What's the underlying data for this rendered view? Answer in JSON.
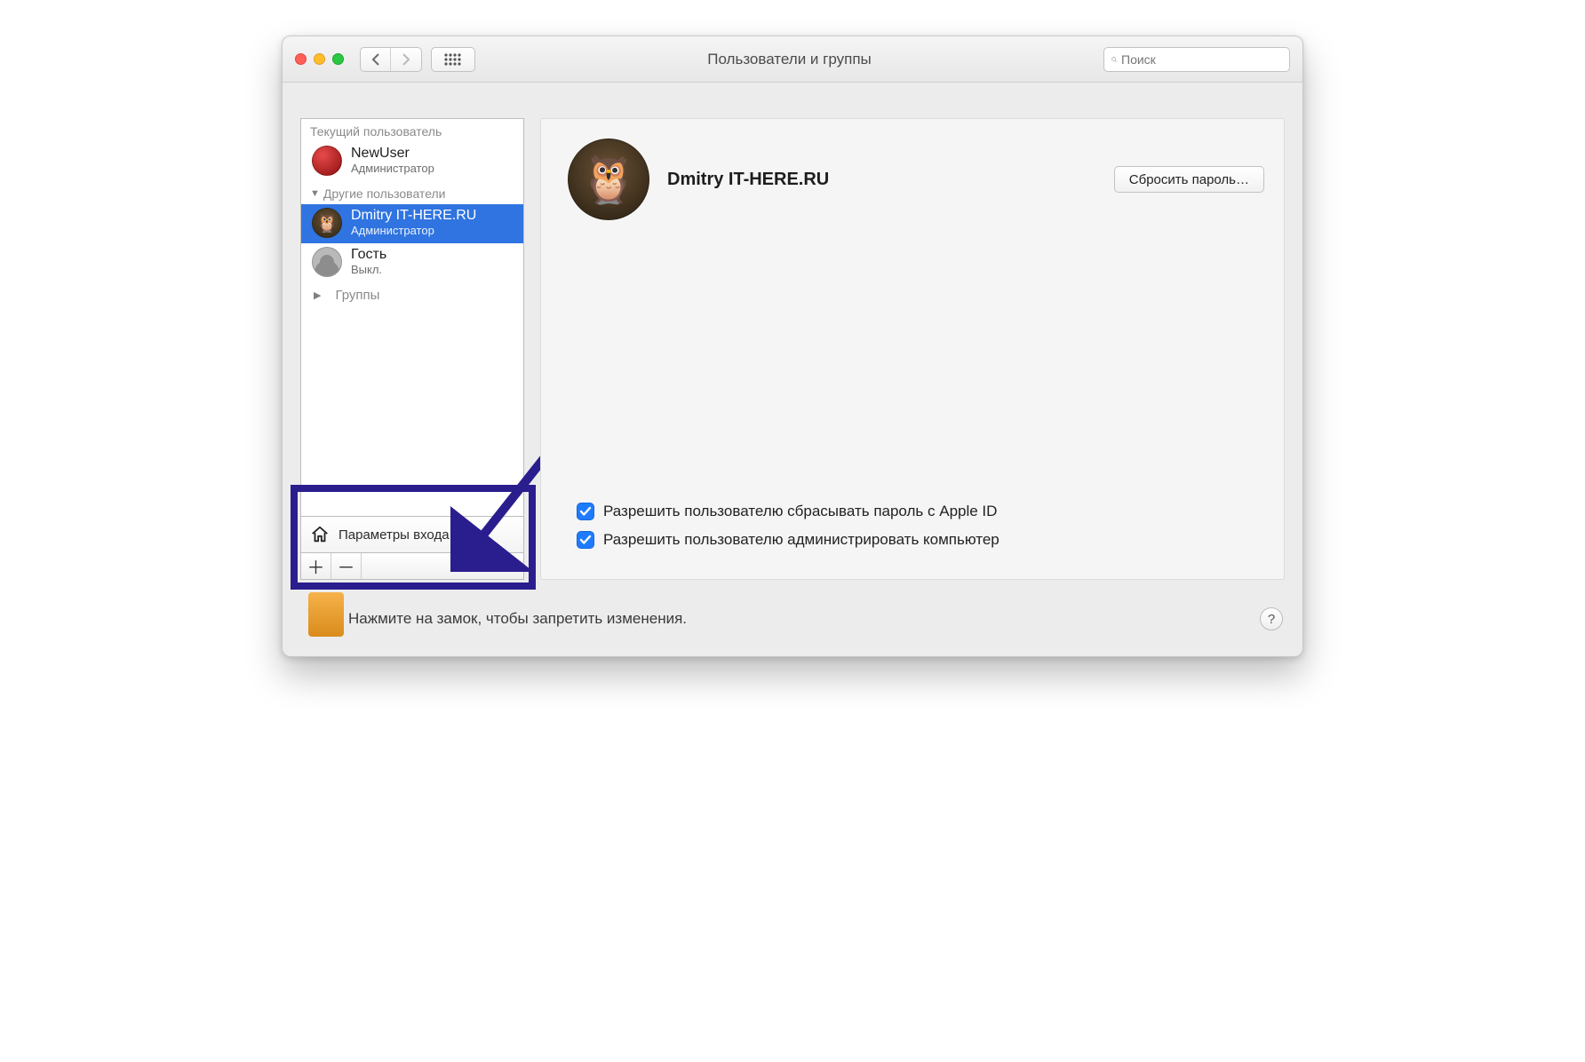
{
  "window": {
    "title": "Пользователи и группы"
  },
  "search": {
    "placeholder": "Поиск"
  },
  "sidebar": {
    "current_user_label": "Текущий пользователь",
    "other_users_label": "Другие пользователи",
    "groups_label": "Группы",
    "login_options_label": "Параметры входа",
    "users": [
      {
        "name": "NewUser",
        "role": "Администратор"
      },
      {
        "name": "Dmitry IT-HERE.RU",
        "role": "Администратор"
      },
      {
        "name": "Гость",
        "role": "Выкл."
      }
    ]
  },
  "main": {
    "user_name": "Dmitry IT-HERE.RU",
    "reset_password_label": "Сбросить пароль…",
    "checks": [
      "Разрешить пользователю сбрасывать пароль с Apple ID",
      "Разрешить пользователю администрировать компьютер"
    ]
  },
  "footer": {
    "lock_hint": "Нажмите на замок, чтобы запретить изменения."
  }
}
